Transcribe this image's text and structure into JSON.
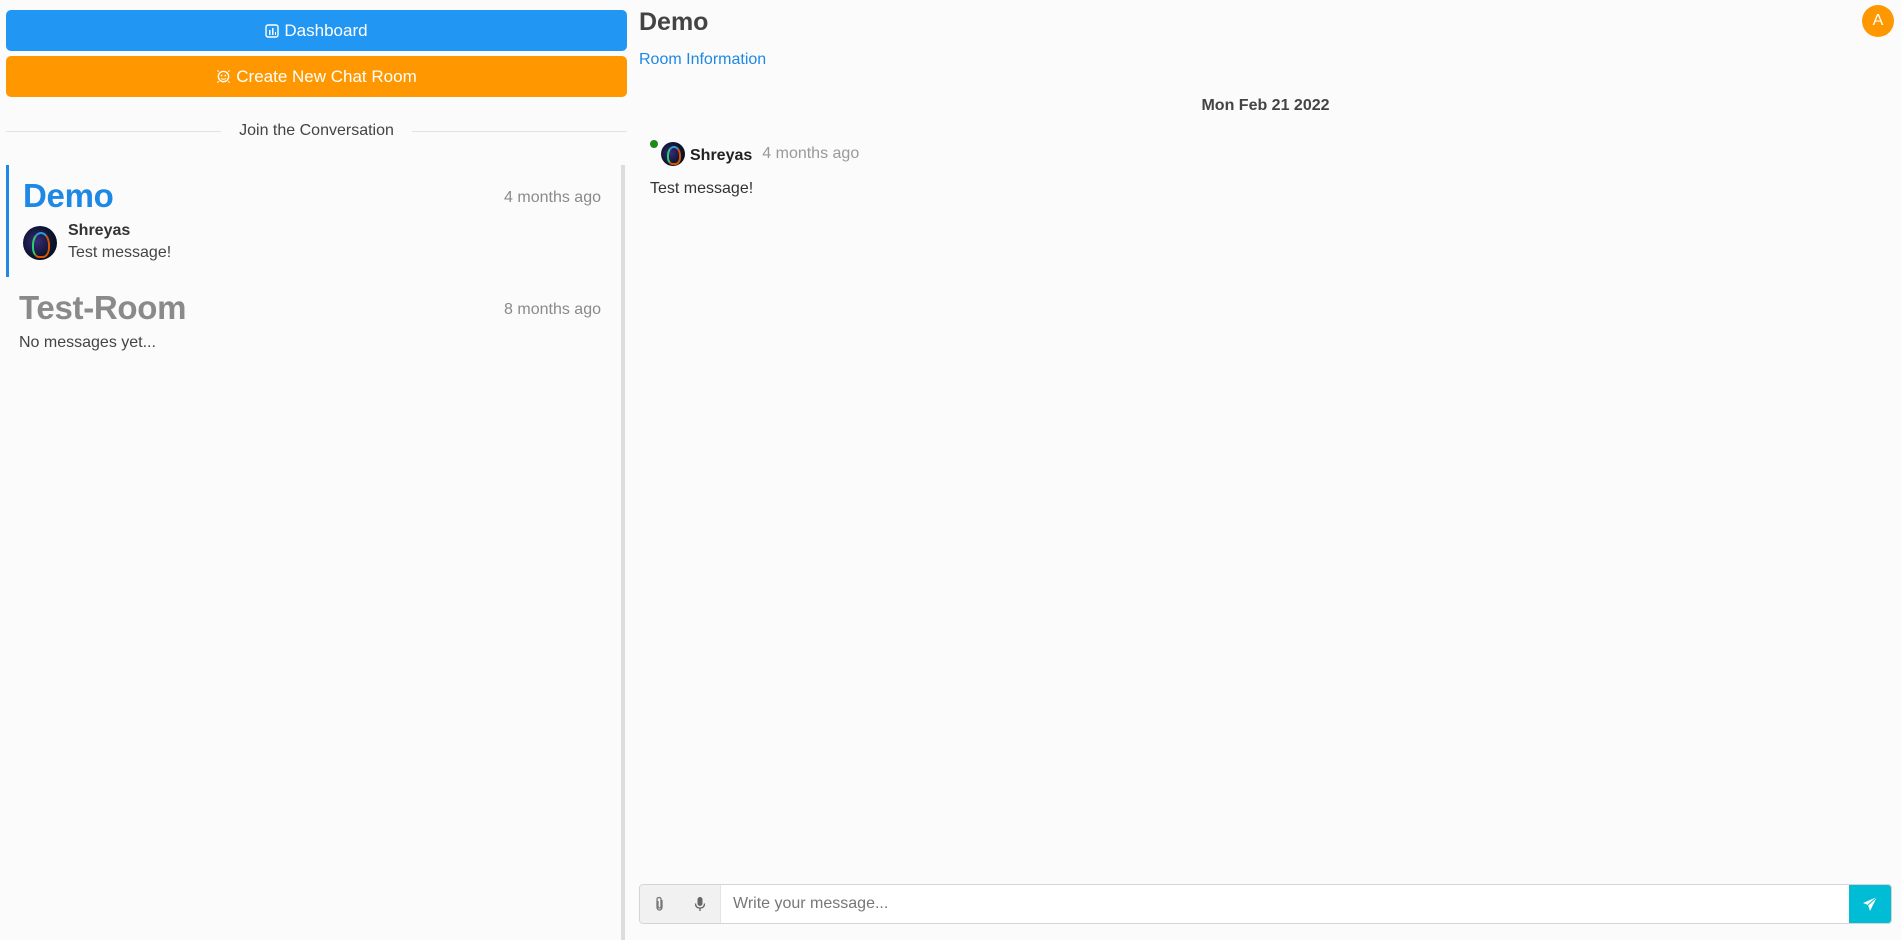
{
  "sidebar": {
    "dashboard_label": "Dashboard",
    "create_room_label": "Create New Chat Room",
    "divider_label": "Join the Conversation",
    "rooms": [
      {
        "name": "Demo",
        "time": "4 months ago",
        "last_sender": "Shreyas",
        "last_message": "Test message!",
        "active": true
      },
      {
        "name": "Test-Room",
        "time": "8 months ago",
        "empty_text": "No messages yet...",
        "active": false
      }
    ]
  },
  "main": {
    "title": "Demo",
    "room_info_link": "Room Information",
    "date_separator": "Mon Feb 21 2022",
    "messages": [
      {
        "author": "Shreyas",
        "time": "4 months ago",
        "text": "Test message!",
        "online": true
      }
    ],
    "user_initial": "A",
    "composer": {
      "placeholder": "Write your message...",
      "value": ""
    }
  },
  "colors": {
    "primary": "#2196f3",
    "accent": "#ff9800",
    "link": "#1e88e5",
    "send": "#00bcd4",
    "online": "#1b8a1b"
  },
  "icons": {
    "dashboard": "chart-bar-icon",
    "create": "chat-bubble-icon",
    "attach": "paperclip-icon",
    "mic": "microphone-icon",
    "send": "send-icon"
  }
}
